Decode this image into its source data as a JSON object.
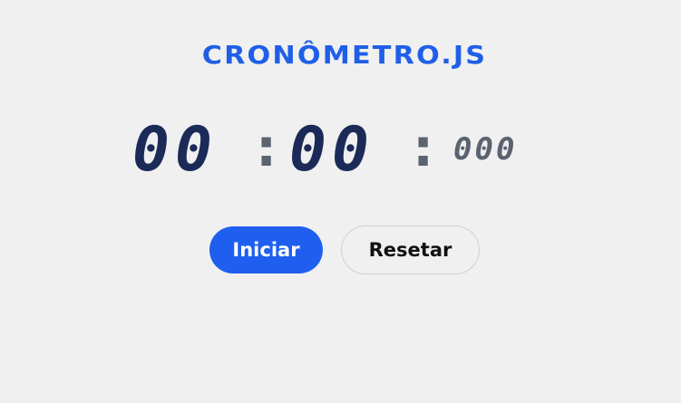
{
  "title": "CRONÔMETRO.JS",
  "timer": {
    "minutes": "00",
    "separator_1": ":",
    "seconds": "00",
    "separator_2": ":",
    "milliseconds": "000"
  },
  "buttons": {
    "start_label": "Iniciar",
    "reset_label": "Resetar"
  },
  "colors": {
    "accent": "#1f5ff0",
    "digits": "#1b2a57",
    "separator": "#5b6270",
    "background": "#f0f0f0"
  }
}
